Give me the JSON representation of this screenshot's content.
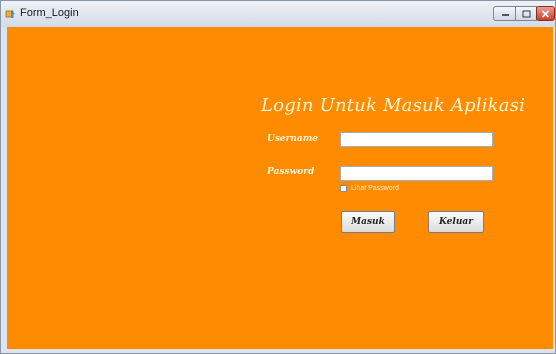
{
  "window": {
    "title": "Form_Login"
  },
  "form": {
    "heading": "Login Untuk Masuk Aplikasi",
    "username_label": "Username",
    "password_label": "Password",
    "username_value": "",
    "password_value": "",
    "show_password_label": "Lihat Password",
    "login_button": "Masuk",
    "exit_button": "Keluar"
  },
  "colors": {
    "background": "#ff8c00",
    "text": "#fff6d8"
  },
  "icons": {
    "app": "app-icon",
    "minimize": "minimize-icon",
    "maximize": "maximize-icon",
    "close": "close-icon"
  }
}
